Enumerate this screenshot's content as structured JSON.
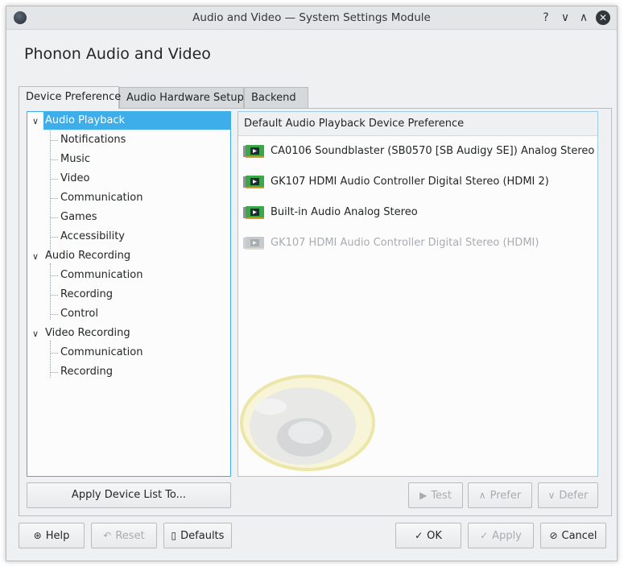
{
  "window": {
    "title": "Audio and Video — System Settings Module",
    "controls": {
      "help": "?",
      "minimize": "∨",
      "maximize": "∧",
      "close": "✕"
    }
  },
  "page_title": "Phonon Audio and Video",
  "tabs": [
    {
      "label": "Device Preference",
      "active": true
    },
    {
      "label": "Audio Hardware Setup",
      "active": false
    },
    {
      "label": "Backend",
      "active": false
    }
  ],
  "tree": {
    "groups": [
      {
        "label": "Audio Playback",
        "selected": true,
        "children": [
          "Notifications",
          "Music",
          "Video",
          "Communication",
          "Games",
          "Accessibility"
        ]
      },
      {
        "label": "Audio Recording",
        "selected": false,
        "children": [
          "Communication",
          "Recording",
          "Control"
        ]
      },
      {
        "label": "Video Recording",
        "selected": false,
        "children": [
          "Communication",
          "Recording"
        ]
      }
    ],
    "expanded_glyph": "∨"
  },
  "device_panel": {
    "header": "Default Audio Playback Device Preference",
    "devices": [
      {
        "label": "CA0106 Soundblaster (SB0570 [SB Audigy SE]) Analog Stereo",
        "enabled": true
      },
      {
        "label": "GK107 HDMI Audio Controller Digital Stereo (HDMI 2)",
        "enabled": true
      },
      {
        "label": "Built-in Audio Analog Stereo",
        "enabled": true
      },
      {
        "label": "GK107 HDMI Audio Controller Digital Stereo (HDMI)",
        "enabled": false
      }
    ]
  },
  "buttons": {
    "apply_device_list": "Apply Device List To...",
    "test": "Test",
    "prefer": "Prefer",
    "defer": "Defer",
    "help": "Help",
    "reset": "Reset",
    "defaults": "Defaults",
    "ok": "OK",
    "apply": "Apply",
    "cancel": "Cancel"
  },
  "colors": {
    "selection": "#3daee9",
    "window_bg": "#eff0f1",
    "view_bg": "#fcfcfc",
    "disabled_text": "#a8acb0",
    "card_green": "#3aa84a"
  }
}
